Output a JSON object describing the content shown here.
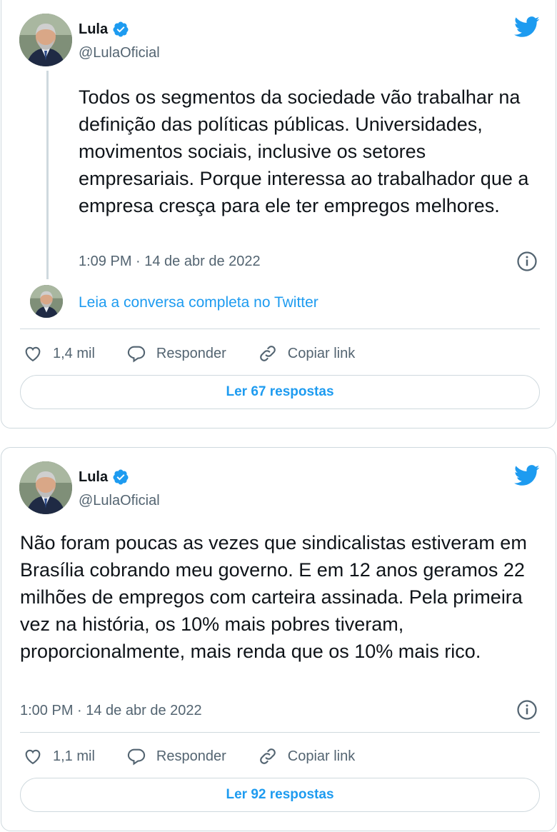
{
  "tweets": [
    {
      "author_name": "Lula",
      "author_handle": "@LulaOficial",
      "text": "Todos os segmentos da sociedade vão trabalhar na definição das políticas públicas. Universidades, movimentos sociais, inclusive os setores empresariais. Porque interessa ao trabalhador que a empresa cresça para ele ter empregos melhores.",
      "timestamp": "1:09 PM · 14 de abr de 2022",
      "read_thread_label": "Leia a conversa completa no Twitter",
      "likes": "1,4 mil",
      "reply_label": "Responder",
      "copy_link_label": "Copiar link",
      "replies_button": "Ler 67 respostas"
    },
    {
      "author_name": "Lula",
      "author_handle": "@LulaOficial",
      "text": "Não foram poucas as vezes que sindicalistas estiveram em Brasília cobrando meu governo. E em 12 anos geramos 22 milhões de empregos com carteira assinada. Pela primeira vez na história, os 10% mais pobres tiveram, proporcionalmente, mais renda que os 10% mais rico.",
      "timestamp": "1:00 PM · 14 de abr de 2022",
      "likes": "1,1 mil",
      "reply_label": "Responder",
      "copy_link_label": "Copiar link",
      "replies_button": "Ler 92 respostas"
    }
  ],
  "colors": {
    "accent": "#1d9bf0",
    "text": "#0f1419",
    "muted": "#536471",
    "border": "#cfd9de"
  },
  "icons": [
    "avatar",
    "verified-badge-icon",
    "twitter-bird-icon",
    "info-icon",
    "heart-icon",
    "reply-icon",
    "link-icon"
  ]
}
